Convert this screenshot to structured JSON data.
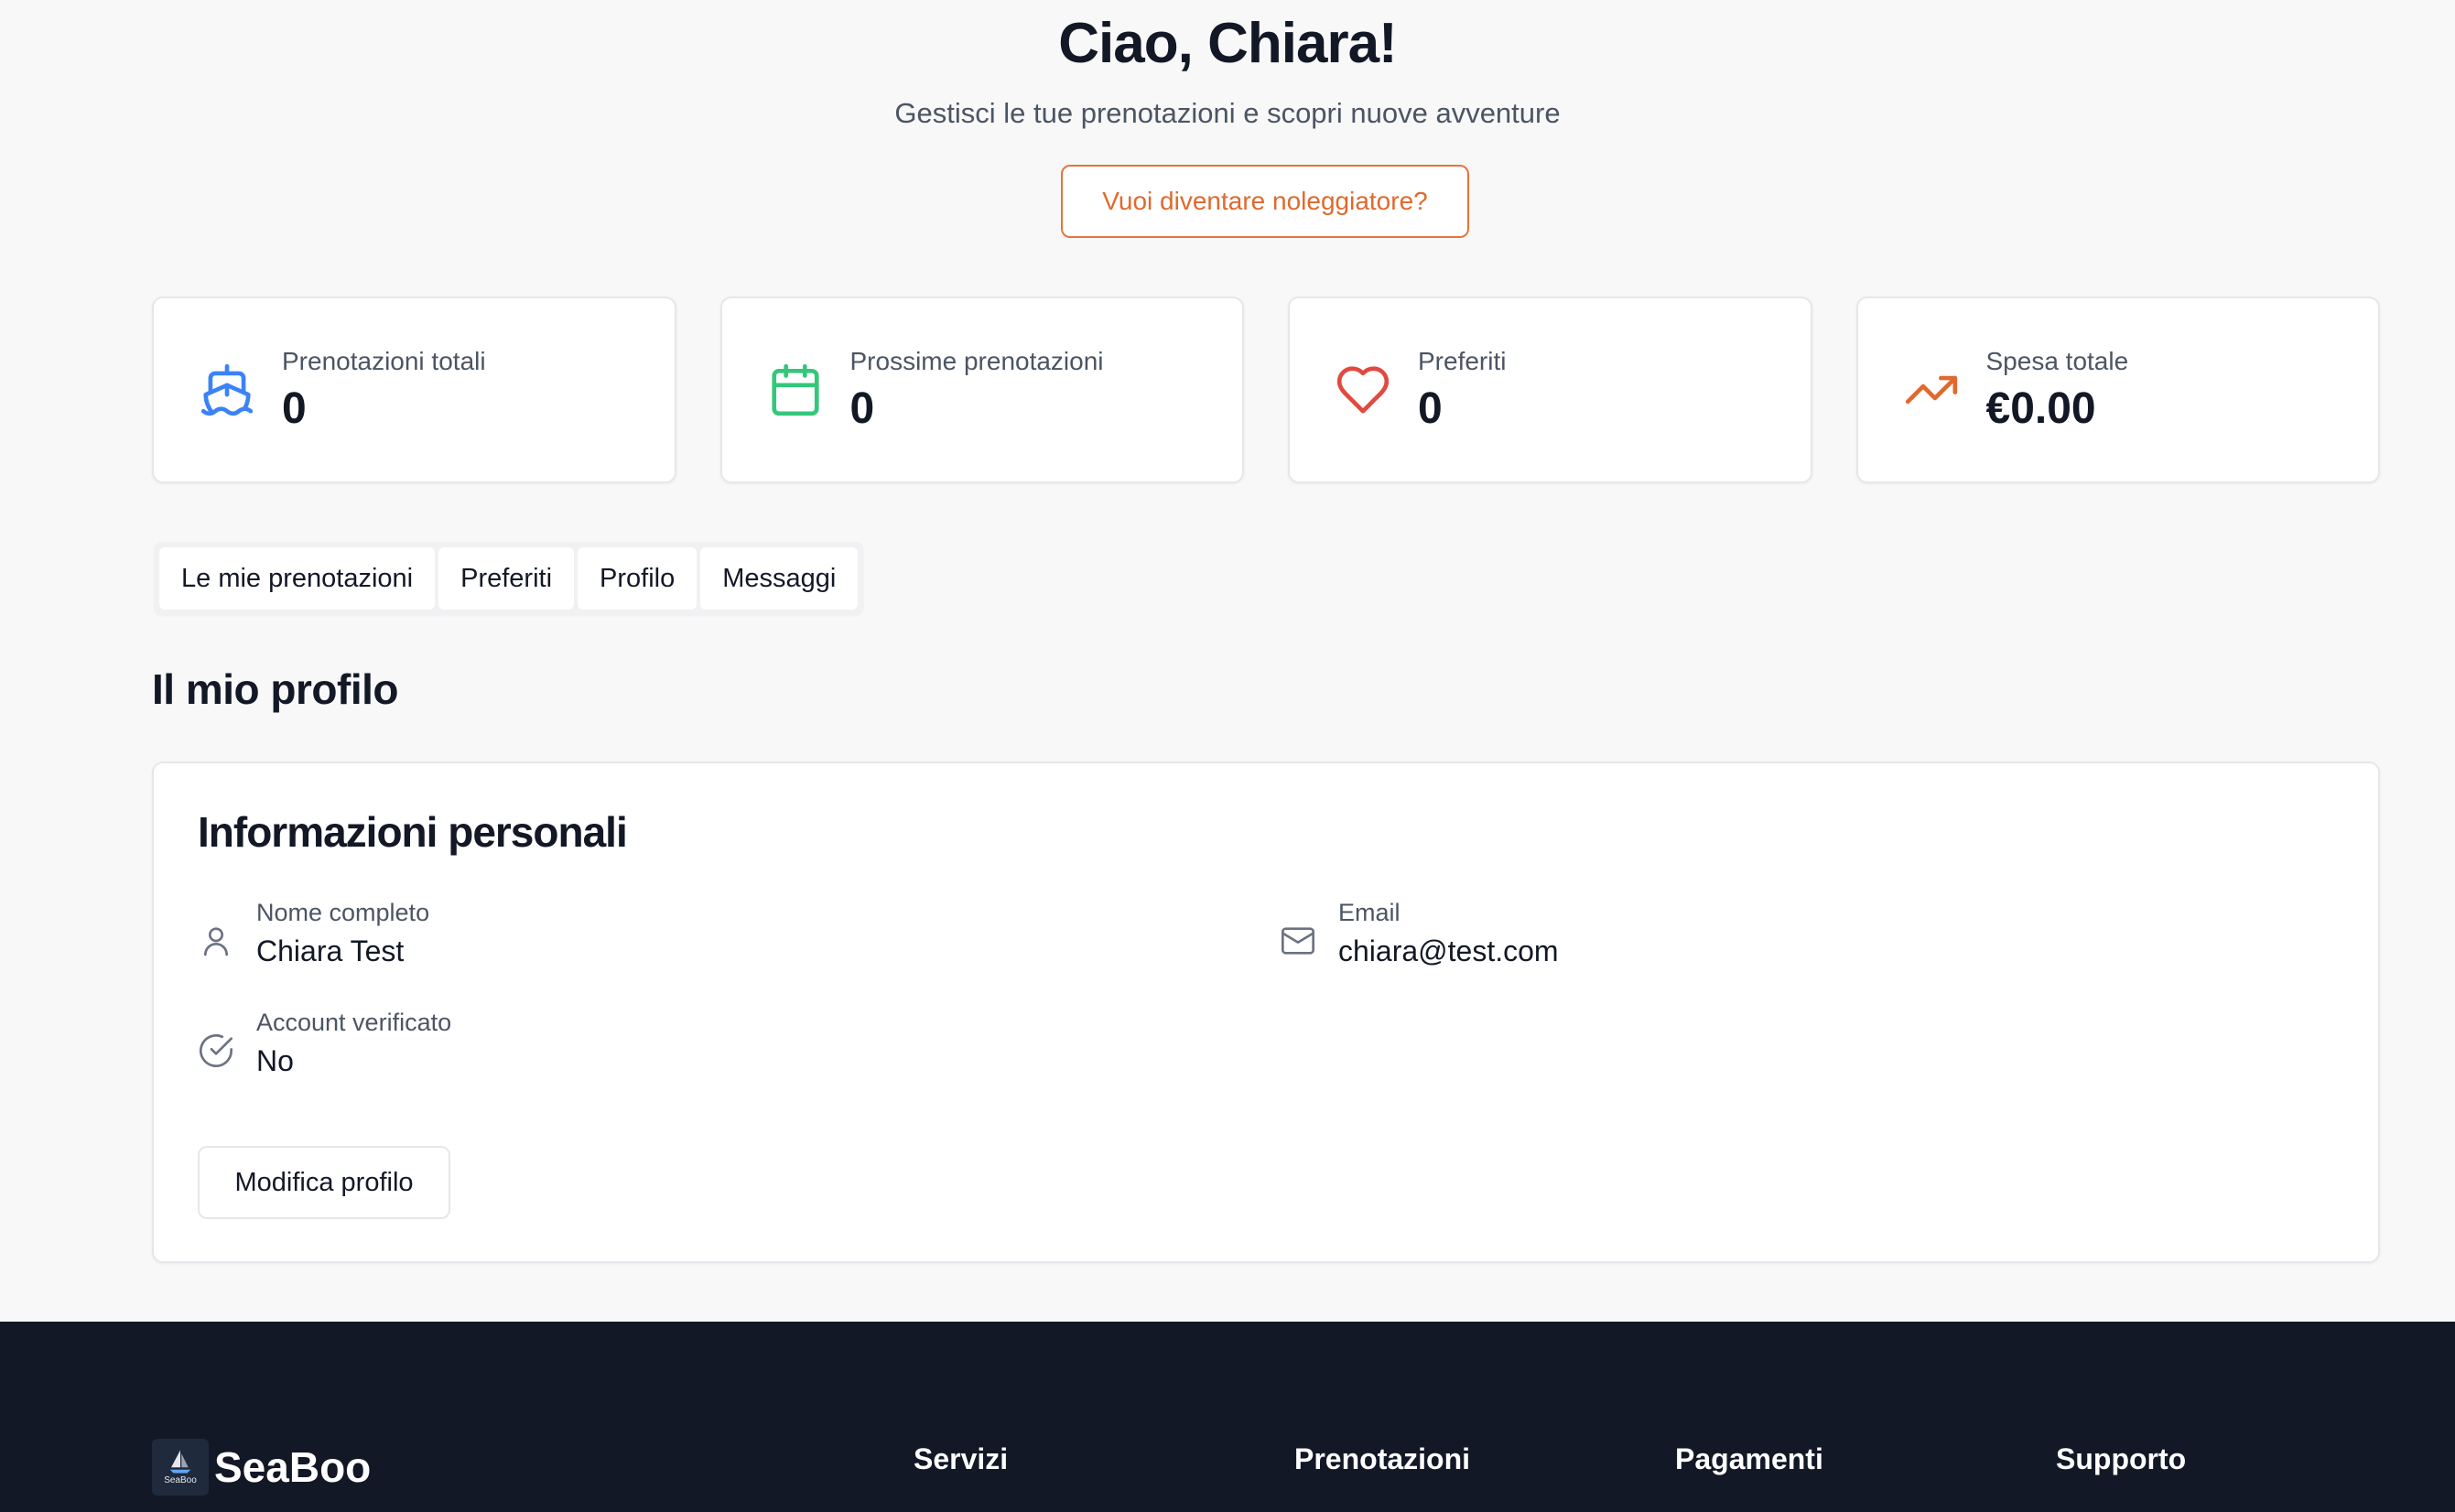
{
  "header": {
    "greeting": "Ciao, Chiara!",
    "subtitle": "Gestisci le tue prenotazioni e scopri nuove avventure",
    "cta_label": "Vuoi diventare noleggiatore?"
  },
  "stats": [
    {
      "label": "Prenotazioni totali",
      "value": "0",
      "icon": "boat-icon",
      "color": "#3b82f6"
    },
    {
      "label": "Prossime prenotazioni",
      "value": "0",
      "icon": "calendar-icon",
      "color": "#34c77b"
    },
    {
      "label": "Preferiti",
      "value": "0",
      "icon": "heart-icon",
      "color": "#e04a3f"
    },
    {
      "label": "Spesa totale",
      "value": "€0.00",
      "icon": "trending-up-icon",
      "color": "#e0692d"
    }
  ],
  "tabs": [
    "Le mie prenotazioni",
    "Preferiti",
    "Profilo",
    "Messaggi"
  ],
  "section_title": "Il mio profilo",
  "profile": {
    "card_title": "Informazioni personali",
    "name_label": "Nome completo",
    "name_value": "Chiara Test",
    "email_label": "Email",
    "email_value": "chiara@test.com",
    "verified_label": "Account verificato",
    "verified_value": "No",
    "edit_label": "Modifica profilo"
  },
  "footer": {
    "logo_name": "SeaBoo",
    "logo_small": "SeaBoo",
    "columns": [
      "Servizi",
      "Prenotazioni",
      "Pagamenti",
      "Supporto"
    ]
  }
}
